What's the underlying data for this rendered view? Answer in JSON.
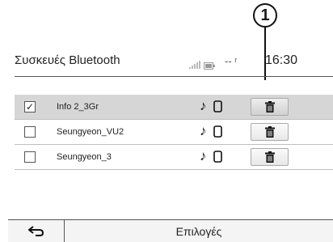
{
  "callout": {
    "number": "1"
  },
  "header": {
    "title": "Συσκευές Bluetooth",
    "time": "16:30",
    "icons": [
      "signal-icon",
      "battery-icon",
      "no-signal-icon"
    ]
  },
  "devices": [
    {
      "name": "Info 2_3Gr",
      "checked": true,
      "selected": true,
      "icons": [
        "music-icon",
        "phone-icon",
        "trash-icon"
      ]
    },
    {
      "name": "Seungyeon_VU2",
      "checked": false,
      "selected": false,
      "icons": [
        "music-icon",
        "phone-icon",
        "trash-icon"
      ]
    },
    {
      "name": "Seungyeon_3",
      "checked": false,
      "selected": false,
      "icons": [
        "music-icon",
        "phone-icon",
        "trash-icon"
      ]
    }
  ],
  "footer": {
    "back_icon": "back-arrow-icon",
    "options_label": "Επιλογές"
  }
}
